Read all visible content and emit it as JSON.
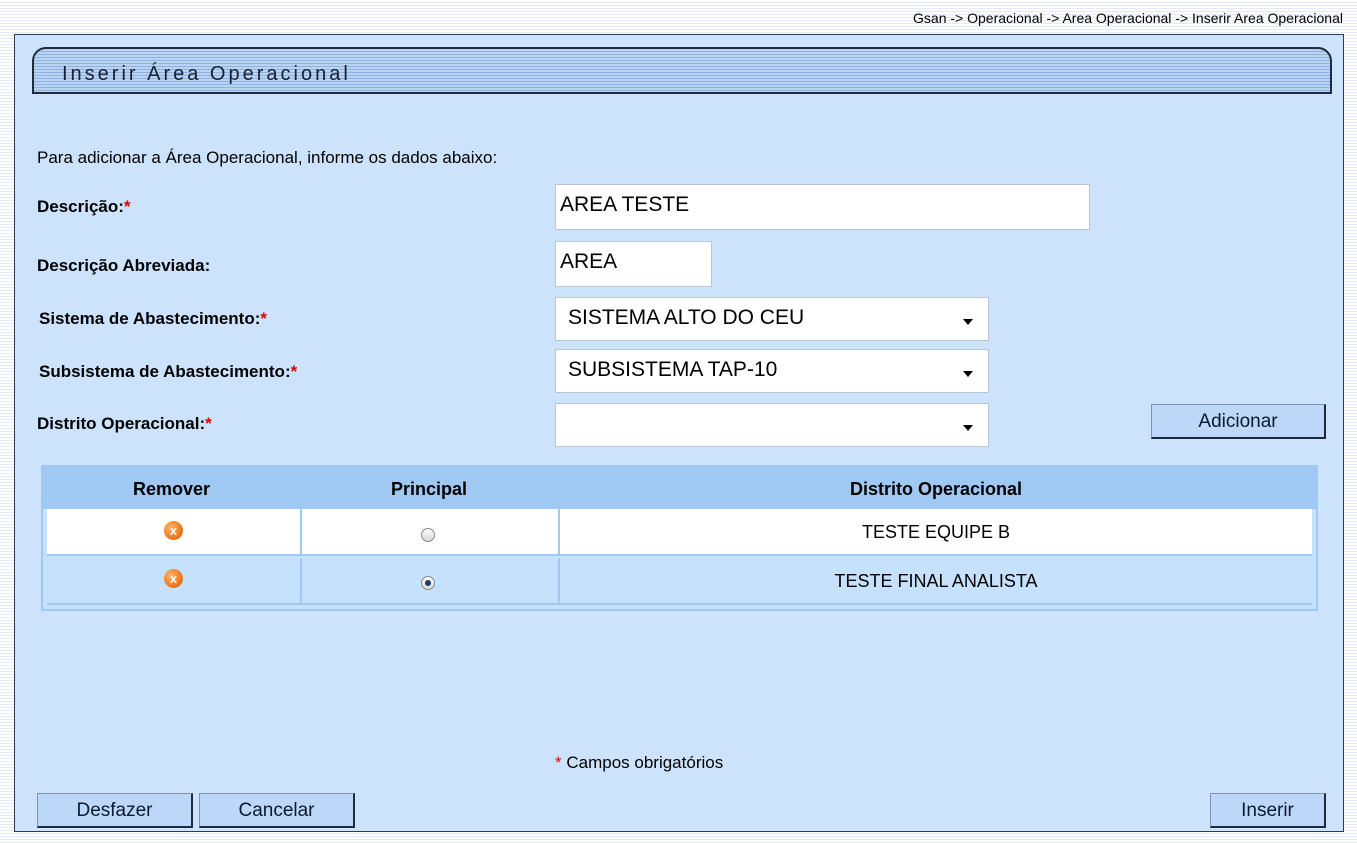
{
  "breadcrumb": "Gsan -> Operacional -> Area Operacional -> Inserir Area Operacional",
  "title": "Inserir Área Operacional",
  "intro": "Para adicionar a Área Operacional, informe os dados abaixo:",
  "required_marker": "*",
  "fields": {
    "descricao": {
      "label": "Descrição:",
      "value": "AREA TESTE",
      "required": true
    },
    "descricao_abreviada": {
      "label": "Descrição Abreviada:",
      "value": "AREA",
      "required": false
    },
    "sistema": {
      "label": "Sistema de Abastecimento:",
      "value": "SISTEMA ALTO DO CEU",
      "required": true
    },
    "subsistema": {
      "label": "Subsistema de Abastecimento:",
      "value": "SUBSISTEMA TAP-10",
      "required": true
    },
    "distrito": {
      "label": "Distrito Operacional:",
      "value": "",
      "required": true
    }
  },
  "buttons": {
    "adicionar": "Adicionar",
    "desfazer": "Desfazer",
    "cancelar": "Cancelar",
    "inserir": "Inserir"
  },
  "table": {
    "headers": [
      "Remover",
      "Principal",
      "Distrito Operacional"
    ],
    "rows": [
      {
        "remove_icon": "remove-icon",
        "principal": false,
        "distrito": "TESTE EQUIPE B"
      },
      {
        "remove_icon": "remove-icon",
        "principal": true,
        "distrito": "TESTE FINAL ANALISTA"
      }
    ]
  },
  "mandatory_note": "Campos obrigatórios",
  "colors": {
    "panel_bg": "#cde3fb",
    "table_header": "#9fc8f2",
    "button_bg": "#bcd7f8",
    "required": "#e00000",
    "remove_icon": "#ef7a1f"
  }
}
